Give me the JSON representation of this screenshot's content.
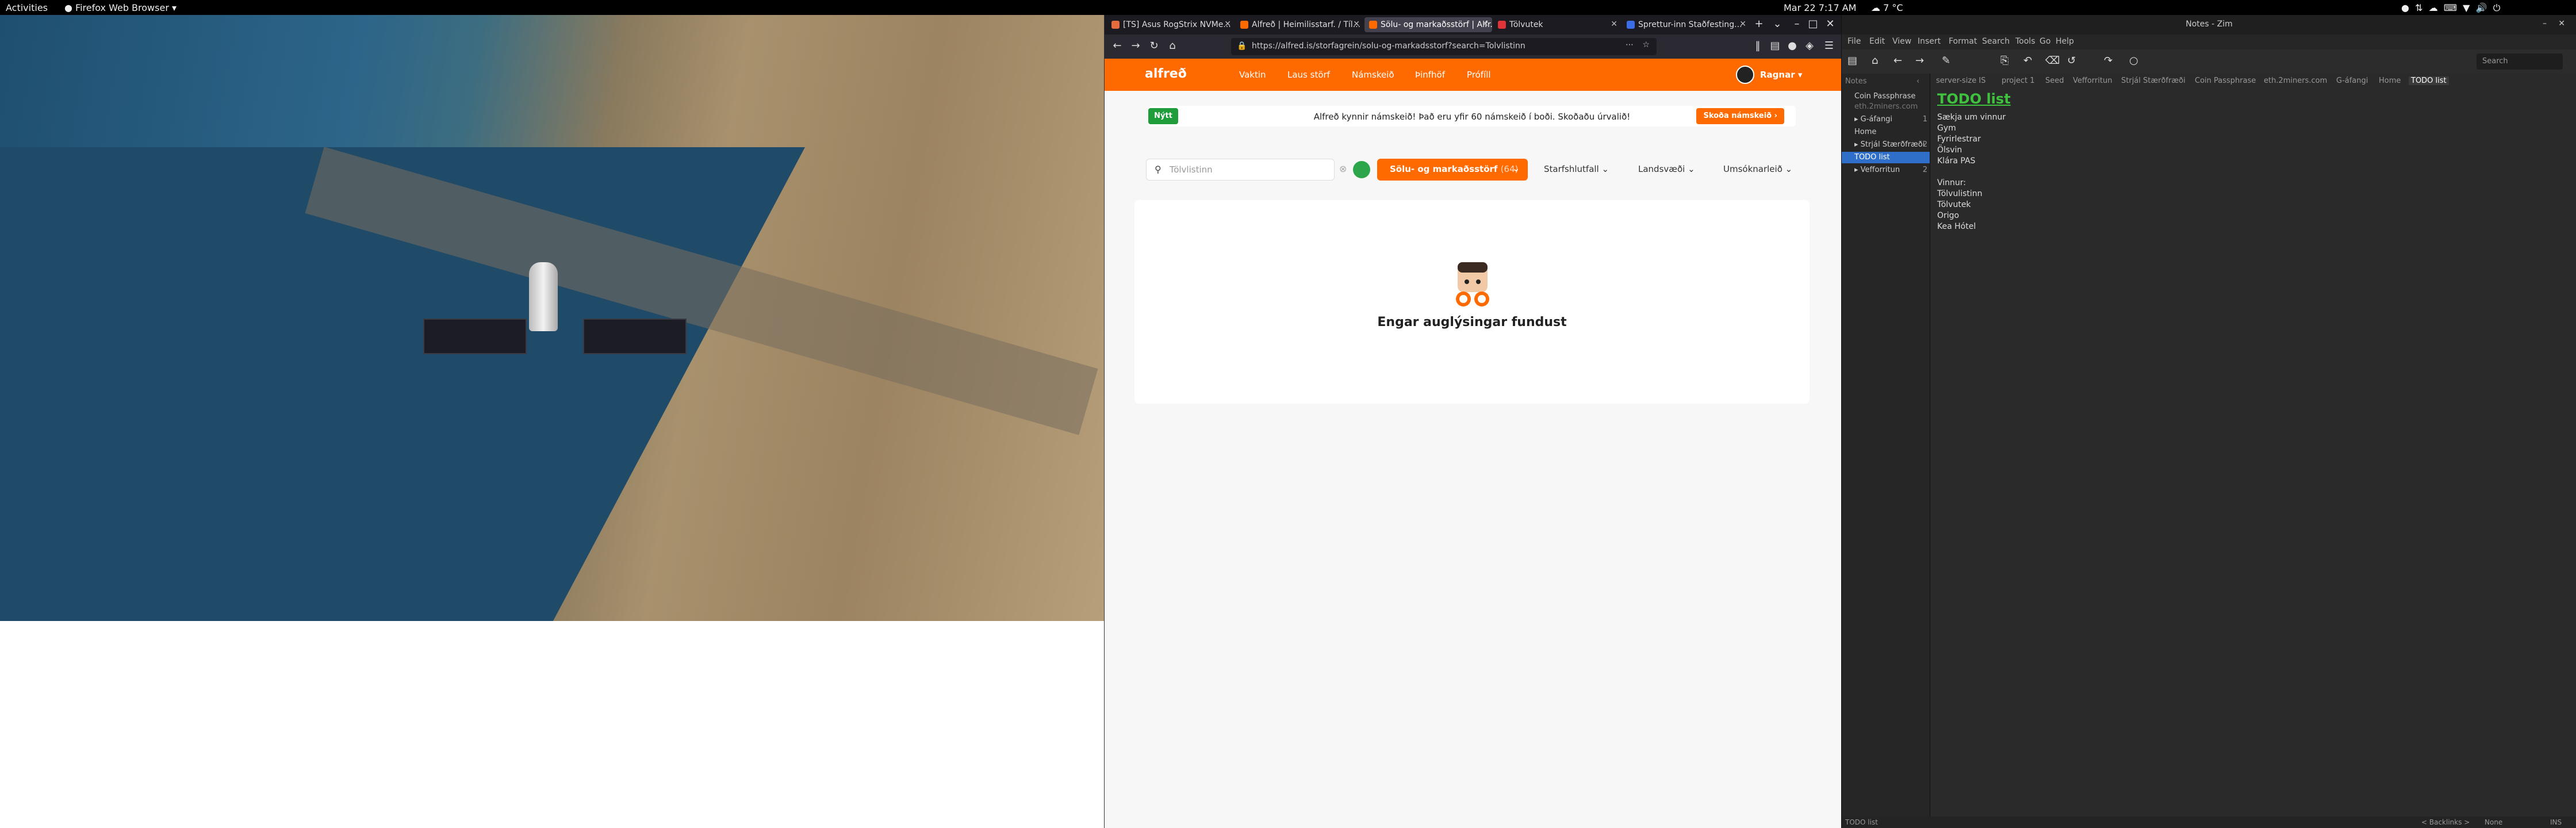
{
  "topbar": {
    "activities": "Activities",
    "app": "Firefox Web Browser",
    "clock": "Mar 22  7:17 AM",
    "weather": "7 °C"
  },
  "firefox": {
    "tabs": [
      {
        "label": "[TS] Asus RogStrix NVMe...",
        "color": "#e66b3d"
      },
      {
        "label": "Alfreð | Heimilisstarf. / Tíl...",
        "color": "#ff6a00"
      },
      {
        "label": "Sölu- og markaðsstörf | Alfr...",
        "color": "#ff6a00"
      },
      {
        "label": "Tölvutek",
        "color": "#e0343a"
      },
      {
        "label": "Sprettur-inn Staðfesting...",
        "color": "#3b6ee6"
      }
    ],
    "url": "https://alfred.is/storfagrein/solu-og-markadsstorf?search=Tolvlistinn"
  },
  "alfred": {
    "logo": "alfreð",
    "nav": [
      "Vaktin",
      "Laus störf",
      "Námskeið",
      "Þinfhöf",
      "Prófíll"
    ],
    "user": "Ragnar",
    "banner": {
      "badge": "Nýtt",
      "text": "Alfreð kynnir námskeið! Það eru yfir 60 námskeið í boði. Skoðaðu úrvalið!",
      "button": "Skoða námskeið"
    },
    "search": {
      "value": "Tölvlistinn"
    },
    "category_button": "Sölu- og markaðsstörf",
    "category_count": "(64)",
    "filters": [
      "Starfshlutfall",
      "Landsvæði",
      "Umsóknarleið"
    ],
    "empty_text": "Engar auglýsingar fundust"
  },
  "zim": {
    "title": "Notes - Zim",
    "menu": [
      "File",
      "Edit",
      "View",
      "Insert",
      "Format",
      "Search",
      "Tools",
      "Go",
      "Help"
    ],
    "search_placeholder": "Search",
    "breadcrumbs": [
      "server-size IS",
      "project 1",
      "Seed",
      "Vefforritun",
      "Strjál Stærðfræði",
      "Coin Passphrase",
      "eth.2miners.com",
      "G-áfangi",
      "Home",
      "TODO list"
    ],
    "sidebar_header": "Notes",
    "sidebar": [
      {
        "label": "Coin Passphrase",
        "count": ""
      },
      {
        "label": "eth.2miners.com",
        "count": ""
      },
      {
        "label": "G-áfangi",
        "count": "1"
      },
      {
        "label": "Home",
        "count": ""
      },
      {
        "label": "Strjál Stærðfræði",
        "count": "2"
      },
      {
        "label": "TODO list",
        "count": ""
      },
      {
        "label": "Vefforritun",
        "count": "2"
      }
    ],
    "page_title": "TODO list",
    "lines": [
      "Sækja um vinnur",
      "Gym",
      "Fyrirlestrar",
      "Ölsvin",
      "Klára PAS",
      "",
      "Vinnur:",
      "Tölvulistinn",
      "Tölvutek",
      "Origo",
      "Kea Hótel"
    ],
    "status_left": "TODO list",
    "status_mid": "< Backlinks >",
    "status_none": "None",
    "status_ins": "INS"
  }
}
